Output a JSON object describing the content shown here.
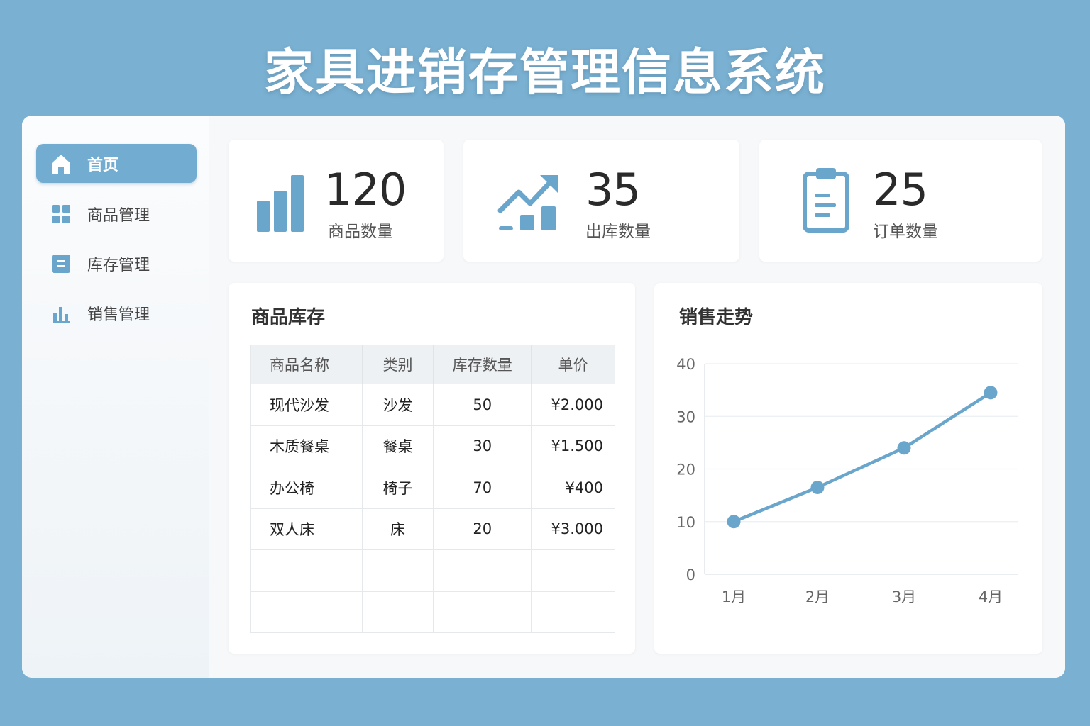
{
  "app": {
    "title": "家具进销存管理信息系统"
  },
  "sidebar": {
    "items": [
      {
        "label": "首页",
        "icon": "home-icon",
        "active": true
      },
      {
        "label": "商品管理",
        "icon": "grid-icon"
      },
      {
        "label": "库存管理",
        "icon": "list-box-icon"
      },
      {
        "label": "销售管理",
        "icon": "bar-chart-icon"
      }
    ]
  },
  "stats": [
    {
      "value": "120",
      "label": "商品数量",
      "icon": "bar-chart-icon"
    },
    {
      "value": "35",
      "label": "出库数量",
      "icon": "trend-up-icon"
    },
    {
      "value": "25",
      "label": "订单数量",
      "icon": "clipboard-icon"
    }
  ],
  "inventory": {
    "title": "商品库存",
    "columns": [
      "商品名称",
      "类别",
      "库存数量",
      "单价"
    ],
    "rows": [
      [
        "现代沙发",
        "沙发",
        "50",
        "¥2.000"
      ],
      [
        "木质餐桌",
        "餐桌",
        "30",
        "¥1.500"
      ],
      [
        "办公椅",
        "椅子",
        "70",
        "¥400"
      ],
      [
        "双人床",
        "床",
        "20",
        "¥3.000"
      ],
      [
        "",
        "",
        "",
        ""
      ],
      [
        "",
        "",
        "",
        ""
      ]
    ]
  },
  "sales": {
    "title": "销售走势"
  },
  "chart_data": {
    "type": "line",
    "categories": [
      "1月",
      "2月",
      "3月",
      "4月"
    ],
    "values": [
      10,
      16.5,
      24,
      34.5
    ],
    "title": "销售走势",
    "ylim": [
      0,
      40
    ],
    "yticks": [
      0,
      10,
      20,
      30,
      40
    ],
    "grid": true,
    "color": "#6aa6cc"
  },
  "colors": {
    "accent": "#72acd0",
    "icon": "#6aa6cc",
    "background": "#7ab0d1"
  }
}
